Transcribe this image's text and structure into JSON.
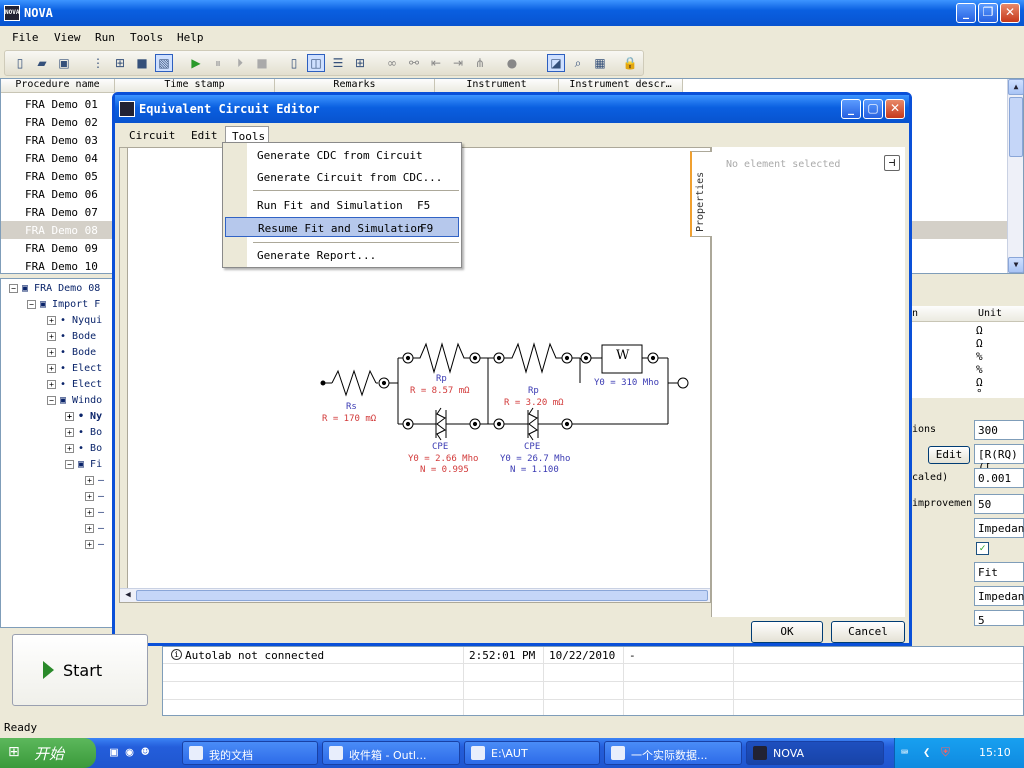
{
  "app": {
    "title": "NOVA",
    "icon_text": "NOVA"
  },
  "menu": [
    "File",
    "View",
    "Run",
    "Tools",
    "Help"
  ],
  "list": {
    "columns": [
      "Procedure name",
      "Time stamp",
      "Remarks",
      "Instrument",
      "Instrument descr…"
    ],
    "rows": [
      "FRA Demo 01",
      "FRA Demo 02",
      "FRA Demo 03",
      "FRA Demo 04",
      "FRA Demo 05",
      "FRA Demo 06",
      "FRA Demo 07",
      "FRA Demo 08",
      "FRA Demo 09",
      "FRA Demo 10"
    ]
  },
  "tree": {
    "root": "FRA Demo 08",
    "import": "Import F",
    "items": [
      "Nyqui",
      "Bode",
      "Bode",
      "Elect",
      "Elect"
    ],
    "window": "Windo",
    "sub": [
      "Ny",
      "Bo",
      "Bo",
      "Fi"
    ]
  },
  "right": {
    "col": "n",
    "unit": "Unit",
    "units": [
      "Ω",
      "Ω",
      "%",
      "%",
      "Ω",
      "°"
    ],
    "labels": [
      "ions",
      "caled)",
      "improvemen",
      "",
      "",
      "",
      "",
      "..."
    ],
    "edit_label": "Edit",
    "values": [
      "300",
      "[R(RQ)([",
      "0.001",
      "50",
      "Impedanc",
      "",
      "Fit",
      "Impedanc",
      "5"
    ]
  },
  "dialog": {
    "title": "Equivalent Circuit Editor",
    "menu": [
      "Circuit",
      "Edit",
      "Tools"
    ],
    "tools_menu": [
      "Generate CDC from Circuit",
      "Generate Circuit from CDC...",
      "Run Fit and Simulation",
      "Resume Fit and Simulation",
      "Generate Report..."
    ],
    "shortcuts": {
      "run": "F5",
      "resume": "F9"
    },
    "properties_tab": "Properties",
    "no_selection": "No element selected",
    "ok": "OK",
    "cancel": "Cancel",
    "circuit": {
      "rs_name": "Rs",
      "rs_val": "R = 170 mΩ",
      "rp1_name": "Rp",
      "rp1_val": "R = 8.57 mΩ",
      "rp2_name": "Rp",
      "rp2_val": "R = 3.20 mΩ",
      "w_name": "W",
      "w_val": "Y0 = 310 Mho",
      "cpe1_name": "CPE",
      "cpe1_y": "Y0 = 2.66 Mho",
      "cpe1_n": "N = 0.995",
      "cpe2_name": "CPE",
      "cpe2_y": "Y0 = 26.7 Mho",
      "cpe2_n": "N = 1.100"
    }
  },
  "start_label": "Start",
  "log": {
    "message": "Autolab not connected",
    "time": "2:52:01 PM",
    "date": "10/22/2010",
    "dash": "-"
  },
  "status": "Ready",
  "taskbar": {
    "start": "开始",
    "tasks": [
      "我的文档",
      "收件箱 - Outl...",
      "E:\\AUT",
      "一个实际数据...",
      "NOVA"
    ],
    "clock": "15:10"
  }
}
